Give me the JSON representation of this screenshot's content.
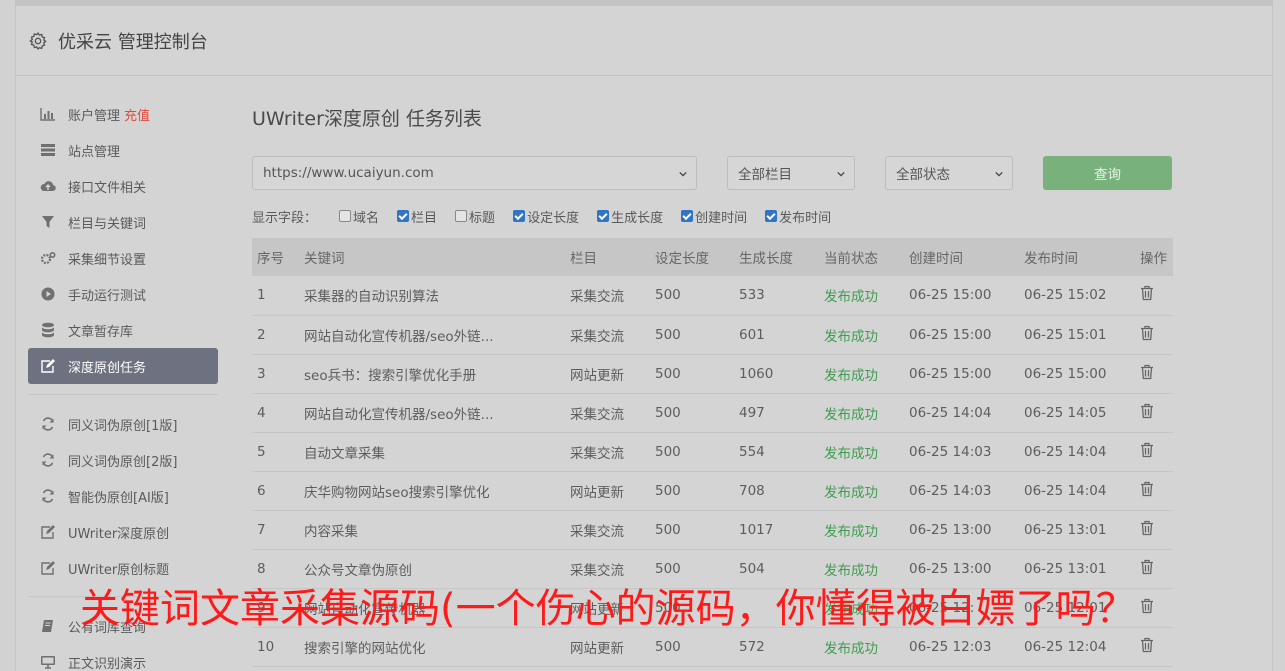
{
  "header": {
    "title": "优采云 管理控制台"
  },
  "sidebar": {
    "groups": [
      [
        {
          "label": "账户管理",
          "extra": "充值",
          "icon": "bar-chart-icon"
        },
        {
          "label": "站点管理",
          "icon": "server-icon"
        },
        {
          "label": "接口文件相关",
          "icon": "cloud-upload-icon"
        },
        {
          "label": "栏目与关键词",
          "icon": "filter-icon"
        },
        {
          "label": "采集细节设置",
          "icon": "gears-icon"
        },
        {
          "label": "手动运行测试",
          "icon": "play-circle-icon"
        },
        {
          "label": "文章暂存库",
          "icon": "database-icon"
        },
        {
          "label": "深度原创任务",
          "icon": "edit-icon",
          "active": true
        }
      ],
      [
        {
          "label": "同义词伪原创[1版]",
          "icon": "refresh-icon"
        },
        {
          "label": "同义词伪原创[2版]",
          "icon": "refresh-icon"
        },
        {
          "label": "智能伪原创[AI版]",
          "icon": "refresh-icon"
        },
        {
          "label": "UWriter深度原创",
          "icon": "edit-icon"
        },
        {
          "label": "UWriter原创标题",
          "icon": "edit-icon"
        }
      ],
      [
        {
          "label": "公有词库查询",
          "icon": "book-icon"
        },
        {
          "label": "正文识别演示",
          "icon": "monitor-icon"
        }
      ]
    ]
  },
  "main": {
    "title": "UWriter深度原创 任务列表",
    "site_select": "https://www.ucaiyun.com",
    "column_select": "全部栏目",
    "status_select": "全部状态",
    "query_label": "查询",
    "fields_label": "显示字段：",
    "fields": [
      {
        "label": "域名",
        "checked": false
      },
      {
        "label": "栏目",
        "checked": true
      },
      {
        "label": "标题",
        "checked": false
      },
      {
        "label": "设定长度",
        "checked": true
      },
      {
        "label": "生成长度",
        "checked": true
      },
      {
        "label": "创建时间",
        "checked": true
      },
      {
        "label": "发布时间",
        "checked": true
      }
    ],
    "columns": [
      "序号",
      "关键词",
      "栏目",
      "设定长度",
      "生成长度",
      "当前状态",
      "创建时间",
      "发布时间",
      "操作"
    ],
    "rows": [
      [
        "1",
        "采集器的自动识别算法",
        "采集交流",
        "500",
        "533",
        "发布成功",
        "06-25 15:00",
        "06-25 15:02"
      ],
      [
        "2",
        "网站自动化宣传机器/seo外链...",
        "采集交流",
        "500",
        "601",
        "发布成功",
        "06-25 15:00",
        "06-25 15:01"
      ],
      [
        "3",
        "seo兵书：搜索引擎优化手册",
        "网站更新",
        "500",
        "1060",
        "发布成功",
        "06-25 15:00",
        "06-25 15:00"
      ],
      [
        "4",
        "网站自动化宣传机器/seo外链...",
        "采集交流",
        "500",
        "497",
        "发布成功",
        "06-25 14:04",
        "06-25 14:05"
      ],
      [
        "5",
        "自动文章采集",
        "采集交流",
        "500",
        "554",
        "发布成功",
        "06-25 14:03",
        "06-25 14:04"
      ],
      [
        "6",
        "庆华购物网站seo搜索引擎优化",
        "网站更新",
        "500",
        "708",
        "发布成功",
        "06-25 14:03",
        "06-25 14:04"
      ],
      [
        "7",
        "内容采集",
        "采集交流",
        "500",
        "1017",
        "发布成功",
        "06-25 13:00",
        "06-25 13:01"
      ],
      [
        "8",
        "公众号文章伪原创",
        "采集交流",
        "500",
        "504",
        "发布成功",
        "06-25 13:00",
        "06-25 13:01"
      ],
      [
        "9",
        "网站自动化宣传机器",
        "网站更新",
        "500",
        "",
        "发布成功",
        "06-25 12:",
        "06-25 12:01"
      ],
      [
        "10",
        "搜索引擎的网站优化",
        "网站更新",
        "500",
        "572",
        "发布成功",
        "06-25 12:03",
        "06-25 12:04"
      ]
    ]
  },
  "overlay": {
    "text": "关键词文章采集源码(一个伤心的源码，你懂得被白嫖了吗？"
  },
  "colors": {
    "active_nav": "#6d7180",
    "query_button": "#79b17c",
    "status_success": "#3e9d4f",
    "overlay_text": "#ff1a1a",
    "charge": "#e34a3b"
  }
}
